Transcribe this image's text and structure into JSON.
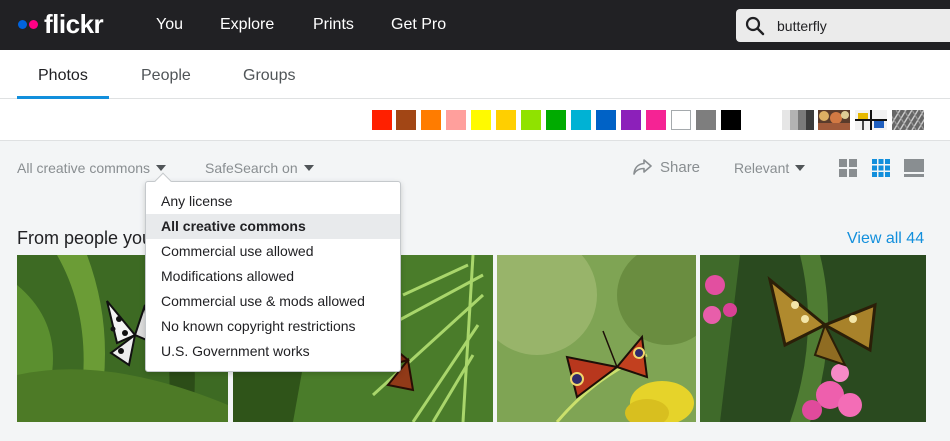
{
  "topnav": {
    "logo": "flickr",
    "items": [
      "You",
      "Explore",
      "Prints",
      "Get Pro"
    ],
    "search_value": "butterfly"
  },
  "tabs": [
    {
      "label": "Photos",
      "active": true
    },
    {
      "label": "People",
      "active": false
    },
    {
      "label": "Groups",
      "active": false
    }
  ],
  "color_filters": [
    "#ff2000",
    "#a24615",
    "#ff7c00",
    "#ff9f9c",
    "#fffa00",
    "#ffcf00",
    "#90e200",
    "#00ab00",
    "#00b2d4",
    "#0062c6",
    "#8c20ba",
    "#f52394",
    "#ffffff",
    "#7e7e7e",
    "#000000"
  ],
  "style_filters": [
    "black-and-white",
    "shallow-depth-of-field",
    "minimalist",
    "patterns"
  ],
  "filters": {
    "license": "All creative commons",
    "safesearch": "SafeSearch on",
    "share": "Share",
    "sort": "Relevant"
  },
  "license_menu": {
    "items": [
      "Any license",
      "All creative commons",
      "Commercial use allowed",
      "Modifications allowed",
      "Commercial use & mods allowed",
      "No known copyright restrictions",
      "U.S. Government works"
    ],
    "selected_index": 1
  },
  "section": {
    "title": "From people you follow",
    "view_all": "View all 44"
  },
  "colors": {
    "accent": "#128fdc",
    "topbar": "#212124",
    "logo_blue": "#0063dc",
    "logo_pink": "#ff0084"
  }
}
